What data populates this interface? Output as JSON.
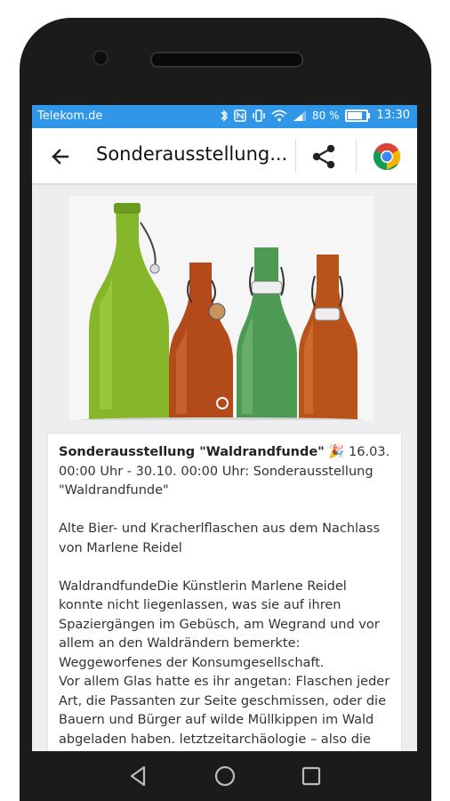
{
  "status_bar": {
    "carrier": "Telekom.de",
    "battery_percent": "80 %",
    "battery_level": 0.8,
    "time": "13:30",
    "icons": [
      "bluetooth-icon",
      "nfc-icon",
      "vibrate-icon",
      "wifi-icon",
      "signal-icon",
      "battery-icon"
    ]
  },
  "app_bar": {
    "title": "Sonderausstellung...",
    "back_icon": "arrow-left-icon",
    "share_icon": "share-icon",
    "browser_icon": "chrome-icon"
  },
  "gallery": {
    "image": "glass-bottles-photo",
    "active_index": 0
  },
  "article": {
    "heading": "Sonderausstellung \"Waldrandfunde\"",
    "emoji": "🎉",
    "date_line": " 16.03. 00:00 Uhr - 30.10. 00:00 Uhr: Sonderausstellung \"Waldrandfunde\"",
    "subtitle": "Alte Bier- und Kracherlflaschen aus dem Nachlass von Marlene Reidel",
    "body_1": "WaldrandfundeDie Künstlerin Marlene Reidel konnte nicht liegenlassen, was sie auf ihren Spaziergängen im Gebüsch, am Wegrand und vor allem an den Waldrändern bemerkte: Weggeworfenes der Konsumgesellschaft.",
    "body_2": "Vor allem Glas hatte es ihr angetan: Flaschen jeder Art, die Passanten zur Seite geschmissen, oder die Bauern und Bürger auf wilde Müllkippen im Wald abgeladen haben. letztzeitarchäologie – also die"
  },
  "nav_bar": {
    "back_icon": "nav-back-icon",
    "home_icon": "nav-home-icon",
    "recents_icon": "nav-recents-icon"
  }
}
